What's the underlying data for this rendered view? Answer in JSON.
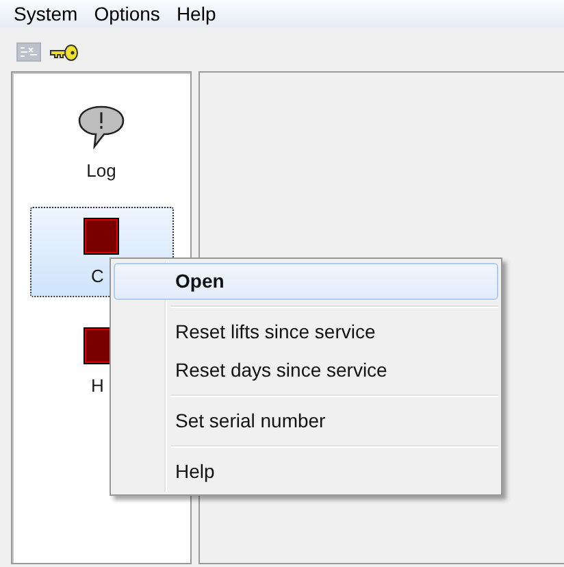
{
  "menubar": {
    "items": [
      {
        "label": "System"
      },
      {
        "label": "Options"
      },
      {
        "label": "Help"
      }
    ]
  },
  "toolbar": {
    "buttons": [
      {
        "kind": "grid",
        "disabled": true
      },
      {
        "kind": "key",
        "disabled": false
      }
    ]
  },
  "sidebar": {
    "items": [
      {
        "kind": "log",
        "label": "Log",
        "selected": false
      },
      {
        "kind": "status",
        "label": "C",
        "selected": true
      },
      {
        "kind": "status",
        "label": "H",
        "selected": false
      }
    ]
  },
  "context_menu": {
    "items": [
      {
        "kind": "item",
        "label": "Open",
        "selected": true
      },
      {
        "kind": "separator"
      },
      {
        "kind": "item",
        "label": "Reset lifts since service",
        "selected": false
      },
      {
        "kind": "item",
        "label": "Reset days since service",
        "selected": false
      },
      {
        "kind": "separator"
      },
      {
        "kind": "item",
        "label": "Set serial number",
        "selected": false
      },
      {
        "kind": "separator"
      },
      {
        "kind": "item",
        "label": "Help",
        "selected": false
      }
    ]
  }
}
